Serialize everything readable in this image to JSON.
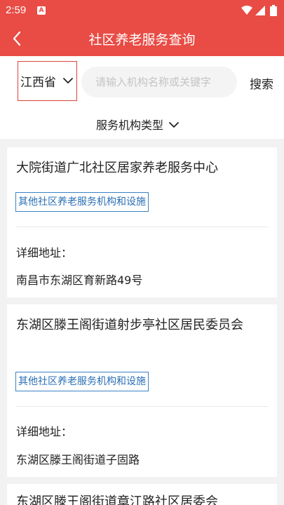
{
  "status_bar": {
    "time": "2:59",
    "notif_glyph": "A"
  },
  "header": {
    "title": "社区养老服务查询"
  },
  "search": {
    "province": "江西省",
    "placeholder": "请输入机构名称或关键字",
    "button": "搜索"
  },
  "filter": {
    "type_label": "服务机构类型"
  },
  "results": [
    {
      "name": "大院街道广北社区居家养老服务中心",
      "tag": "其他社区养老服务机构和设施",
      "address_label": "详细地址：",
      "address": "南昌市东湖区育新路49号"
    },
    {
      "name": "东湖区滕王阁街道射步亭社区居民委员会",
      "tag": "其他社区养老服务机构和设施",
      "address_label": "详细地址：",
      "address": "东湖区滕王阁街道子固路"
    },
    {
      "name": "东湖区滕王阁街道章江路社区居委会"
    }
  ],
  "colors": {
    "brand": "#e84c45",
    "tag_blue": "#2a6fb5"
  }
}
